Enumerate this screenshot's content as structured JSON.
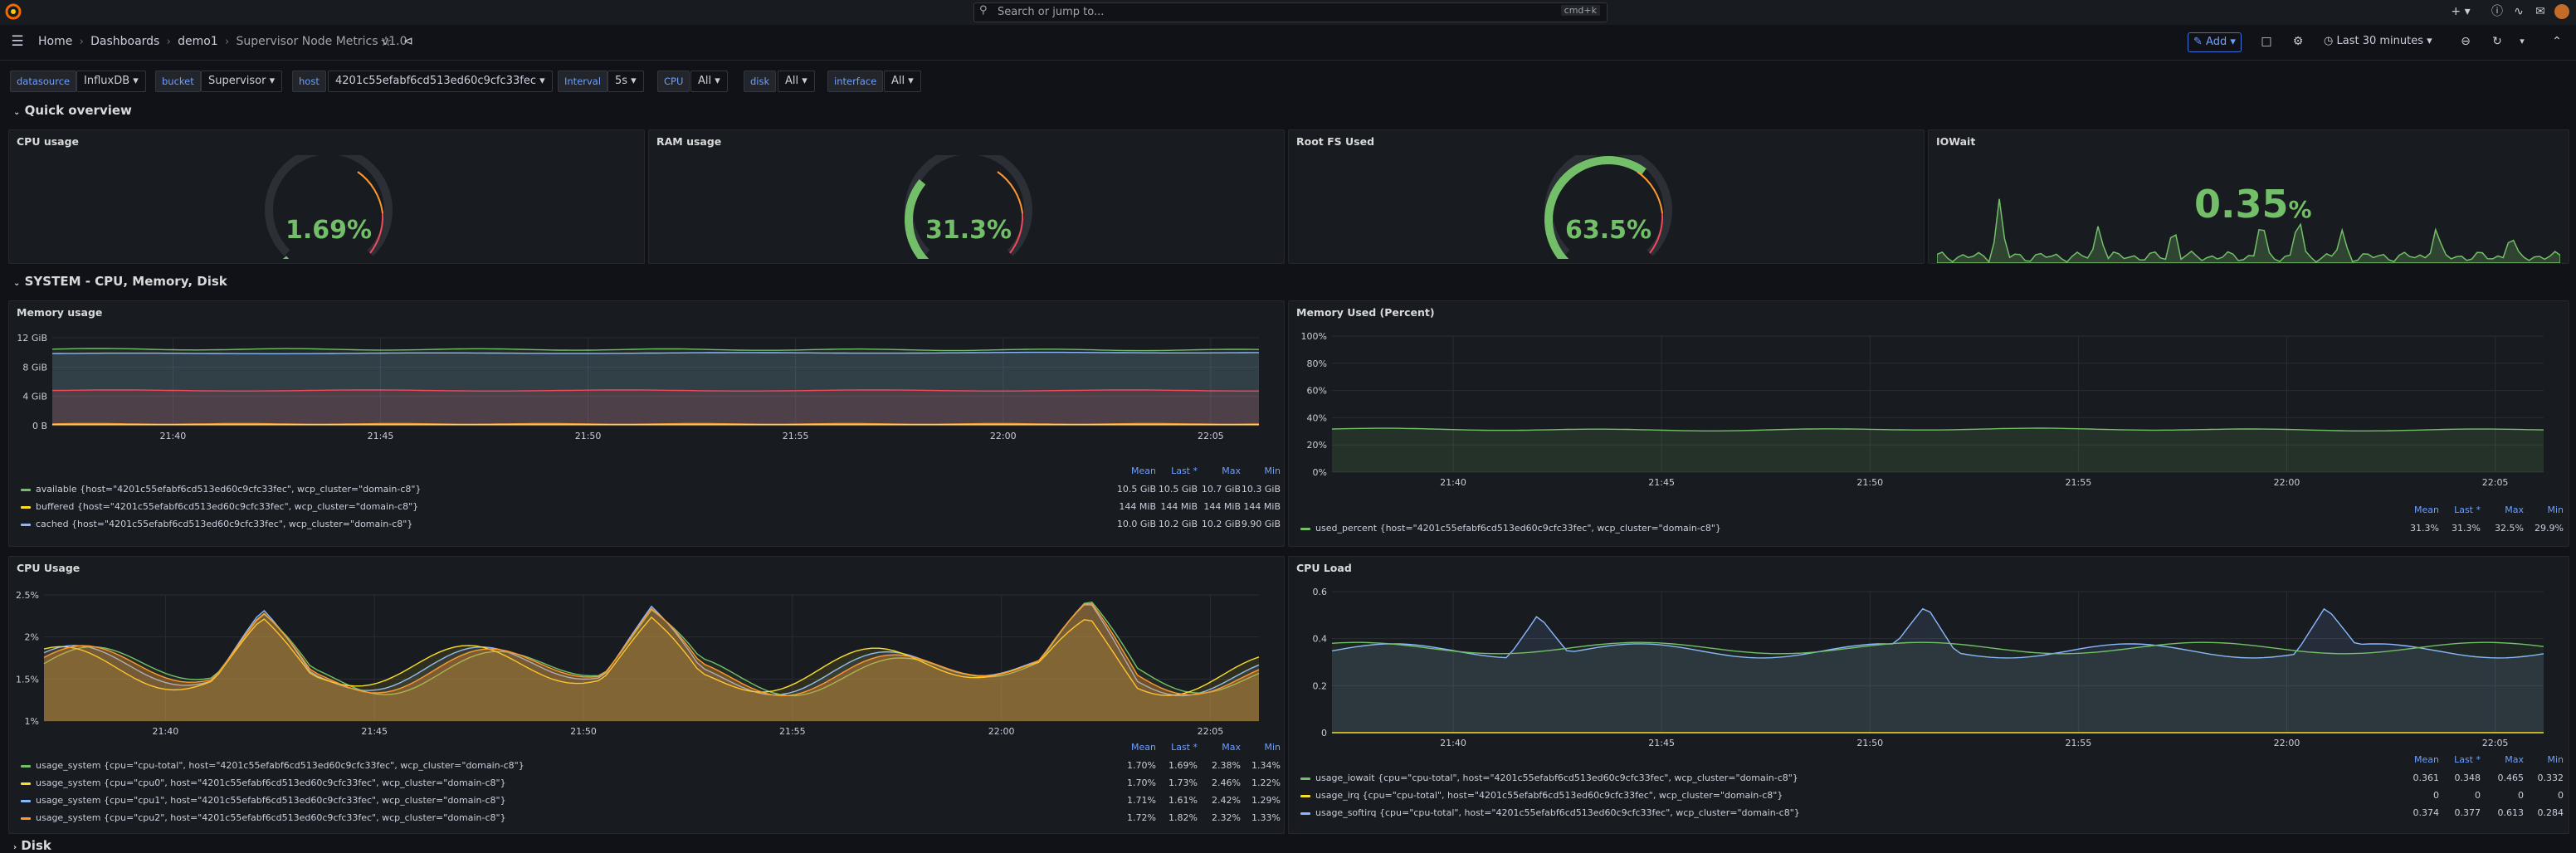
{
  "topbar": {
    "breadcrumb": [
      "Home",
      "Dashboards",
      "demo1",
      "Supervisor Node Metrics v1.0"
    ],
    "search_placeholder": "Search or jump to...",
    "search_shortcut": "cmd+k",
    "add_label": "Add",
    "time_range": "Last 30 minutes"
  },
  "variables": [
    {
      "label": "datasource",
      "value": "InfluxDB"
    },
    {
      "label": "bucket",
      "value": "Supervisor"
    },
    {
      "label": "host",
      "value": "4201c55efabf6cd513ed60c9cfc33fec"
    },
    {
      "label": "Interval",
      "value": "5s"
    },
    {
      "label": "CPU",
      "value": "All"
    },
    {
      "label": "disk",
      "value": "All"
    },
    {
      "label": "interface",
      "value": "All"
    }
  ],
  "rows": {
    "quick": "Quick overview",
    "system": "SYSTEM - CPU, Memory, Disk",
    "disk": "Disk"
  },
  "stats": {
    "cpu": {
      "title": "CPU usage",
      "value": "1.69%",
      "percent": 1.69
    },
    "ram": {
      "title": "RAM usage",
      "value": "31.3%",
      "percent": 31.3
    },
    "rootfs": {
      "title": "Root FS Used",
      "value": "63.5%",
      "percent": 63.5
    },
    "iowait": {
      "title": "IOWait",
      "value": "0.35",
      "unit": "%"
    }
  },
  "colors": {
    "green": "#73bf69",
    "yellow": "#fade2a",
    "blue": "#8ab8ff",
    "orange": "#ff9830",
    "red": "#f2495c",
    "accent": "#6e9fff"
  },
  "memory_usage": {
    "title": "Memory usage",
    "headers": [
      "Mean",
      "Last *",
      "Max",
      "Min"
    ],
    "series": [
      {
        "name": "available {host=\"4201c55efabf6cd513ed60c9cfc33fec\", wcp_cluster=\"domain-c8\"}",
        "color": "#73bf69",
        "stats": [
          "10.5 GiB",
          "10.5 GiB",
          "10.7 GiB",
          "10.3 GiB"
        ]
      },
      {
        "name": "buffered {host=\"4201c55efabf6cd513ed60c9cfc33fec\", wcp_cluster=\"domain-c8\"}",
        "color": "#fade2a",
        "stats": [
          "144 MiB",
          "144 MiB",
          "144 MiB",
          "144 MiB"
        ]
      },
      {
        "name": "cached {host=\"4201c55efabf6cd513ed60c9cfc33fec\", wcp_cluster=\"domain-c8\"}",
        "color": "#8ab8ff",
        "stats": [
          "10.0 GiB",
          "10.2 GiB",
          "10.2 GiB",
          "9.90 GiB"
        ]
      }
    ]
  },
  "memory_used": {
    "title": "Memory Used (Percent)",
    "headers": [
      "Mean",
      "Last *",
      "Max",
      "Min"
    ],
    "series": [
      {
        "name": "used_percent {host=\"4201c55efabf6cd513ed60c9cfc33fec\", wcp_cluster=\"domain-c8\"}",
        "color": "#73bf69",
        "stats": [
          "31.3%",
          "31.3%",
          "32.5%",
          "29.9%"
        ]
      }
    ]
  },
  "cpu_usage": {
    "title": "CPU Usage",
    "headers": [
      "Mean",
      "Last *",
      "Max",
      "Min"
    ],
    "series": [
      {
        "name": "usage_system {cpu=\"cpu-total\", host=\"4201c55efabf6cd513ed60c9cfc33fec\", wcp_cluster=\"domain-c8\"}",
        "color": "#73bf69",
        "stats": [
          "1.70%",
          "1.69%",
          "2.38%",
          "1.34%"
        ]
      },
      {
        "name": "usage_system {cpu=\"cpu0\", host=\"4201c55efabf6cd513ed60c9cfc33fec\", wcp_cluster=\"domain-c8\"}",
        "color": "#fade2a",
        "stats": [
          "1.70%",
          "1.73%",
          "2.46%",
          "1.22%"
        ]
      },
      {
        "name": "usage_system {cpu=\"cpu1\", host=\"4201c55efabf6cd513ed60c9cfc33fec\", wcp_cluster=\"domain-c8\"}",
        "color": "#8ab8ff",
        "stats": [
          "1.71%",
          "1.61%",
          "2.42%",
          "1.29%"
        ]
      },
      {
        "name": "usage_system {cpu=\"cpu2\", host=\"4201c55efabf6cd513ed60c9cfc33fec\", wcp_cluster=\"domain-c8\"}",
        "color": "#ff9830",
        "stats": [
          "1.72%",
          "1.82%",
          "2.32%",
          "1.33%"
        ]
      }
    ]
  },
  "cpu_load": {
    "title": "CPU Load",
    "headers": [
      "Mean",
      "Last *",
      "Max",
      "Min"
    ],
    "series": [
      {
        "name": "usage_iowait {cpu=\"cpu-total\", host=\"4201c55efabf6cd513ed60c9cfc33fec\", wcp_cluster=\"domain-c8\"}",
        "color": "#73bf69",
        "stats": [
          "0.361",
          "0.348",
          "0.465",
          "0.332"
        ]
      },
      {
        "name": "usage_irq {cpu=\"cpu-total\", host=\"4201c55efabf6cd513ed60c9cfc33fec\", wcp_cluster=\"domain-c8\"}",
        "color": "#fade2a",
        "stats": [
          "0",
          "0",
          "0",
          "0"
        ]
      },
      {
        "name": "usage_softirq {cpu=\"cpu-total\", host=\"4201c55efabf6cd513ed60c9cfc33fec\", wcp_cluster=\"domain-c8\"}",
        "color": "#8ab8ff",
        "stats": [
          "0.374",
          "0.377",
          "0.613",
          "0.284"
        ]
      }
    ]
  },
  "axes": {
    "time_ticks": [
      "21:40",
      "21:45",
      "21:50",
      "21:55",
      "22:00",
      "22:05"
    ],
    "mem_y": [
      "12 GiB",
      "8 GiB",
      "4 GiB",
      "0 B"
    ],
    "memp_y": [
      "100%",
      "80%",
      "60%",
      "40%",
      "20%",
      "0%"
    ],
    "cpu_y": [
      "2.5%",
      "2%",
      "1.5%",
      "1%"
    ],
    "load_y": [
      "0.6",
      "0.4",
      "0.2",
      "0"
    ]
  }
}
